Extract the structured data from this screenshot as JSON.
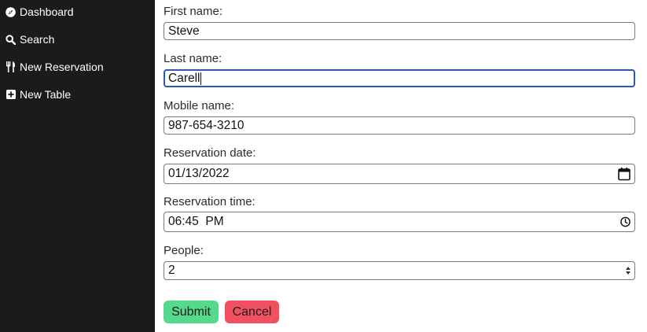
{
  "sidebar": {
    "items": [
      {
        "label": "Dashboard",
        "icon": "compass-icon"
      },
      {
        "label": "Search",
        "icon": "search-icon"
      },
      {
        "label": "New Reservation",
        "icon": "utensils-icon"
      },
      {
        "label": "New Table",
        "icon": "plus-square-icon"
      }
    ]
  },
  "form": {
    "first_name": {
      "label": "First name:",
      "value": "Steve"
    },
    "last_name": {
      "label": "Last name:",
      "value": "Carell"
    },
    "mobile": {
      "label": "Mobile name:",
      "value": "987-654-3210"
    },
    "date": {
      "label": "Reservation date:",
      "value": "01/13/2022"
    },
    "time": {
      "label": "Reservation time:",
      "value": "06:45  PM"
    },
    "people": {
      "label": "People:",
      "value": "2"
    },
    "submit_label": "Submit",
    "cancel_label": "Cancel"
  },
  "colors": {
    "sidebar_bg": "#1b1b1b",
    "focus_border": "#2a5ab2",
    "submit_bg": "#55d98a",
    "cancel_bg": "#f0505f"
  }
}
